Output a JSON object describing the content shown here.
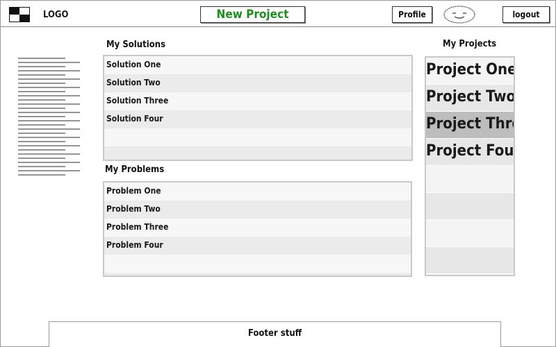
{
  "header": {
    "logo_text": "LOGO",
    "new_project_label": "New Project",
    "profile_label": "Profile",
    "logout_label": "logout",
    "new_project_color": "#1e8f1e"
  },
  "solutions": {
    "title": "My Solutions",
    "rows": [
      "Solution One",
      "Solution Two",
      "Solution Three",
      "Solution Four",
      "",
      ""
    ]
  },
  "problems": {
    "title": "My Problems",
    "rows": [
      "Problem One",
      "Problem Two",
      "Problem Three",
      "Problem Four",
      "",
      ""
    ]
  },
  "projects": {
    "title": "My Projects",
    "rows": [
      "Project One",
      "Project Two",
      "Project Three",
      "Project Four",
      "",
      "",
      "",
      ""
    ],
    "selected_index": 2
  },
  "footer": {
    "text": "Footer stuff"
  },
  "icons": {
    "logo": "logo-mark-icon",
    "avatar": "smiley-face-icon"
  }
}
